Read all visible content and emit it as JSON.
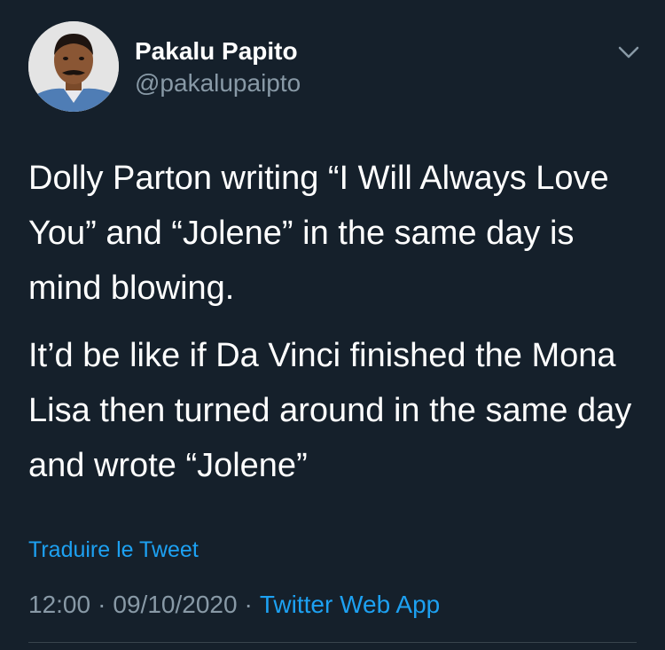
{
  "tweet": {
    "author": {
      "display_name": "Pakalu Papito",
      "username": "@pakalupaipto",
      "avatar_icon": "profile-photo"
    },
    "menu_icon": "chevron-down-icon",
    "paragraphs": [
      "Dolly Parton writing “I Will Always Love You” and “Jolene” in the same day is mind blowing.",
      "It’d be like if Da Vinci finished the Mona Lisa then turned around in the same day and wrote “Jolene”"
    ],
    "translate_label": "Traduire le Tweet",
    "time": "12:00",
    "date": "09/10/2020",
    "separator": "·",
    "source": "Twitter Web App"
  },
  "colors": {
    "background": "#15202b",
    "text": "#ffffff",
    "secondary_text": "#8899a6",
    "link": "#1da1f2",
    "divider": "#38444d"
  }
}
